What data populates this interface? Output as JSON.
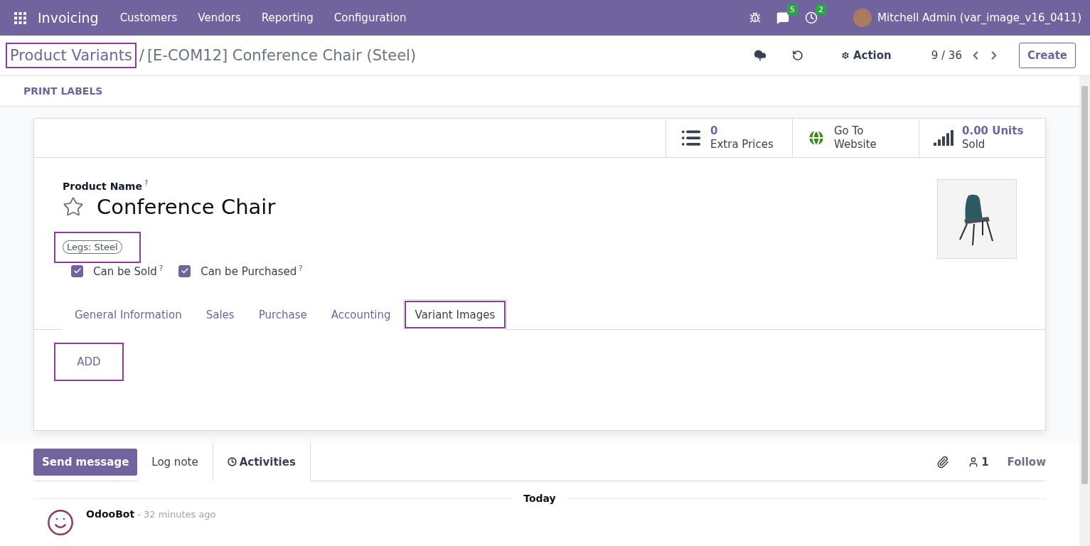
{
  "navbar": {
    "app": "Invoicing",
    "menus": [
      "Customers",
      "Vendors",
      "Reporting",
      "Configuration"
    ],
    "messages_count": "5",
    "activities_count": "2",
    "user": "Mitchell Admin (var_image_v16_0411)"
  },
  "breadcrumb": {
    "parent": "Product Variants",
    "parent_highlighted": true,
    "separator": "/",
    "current": "[E-COM12] Conference Chair (Steel)"
  },
  "control_panel": {
    "action": "Action",
    "pager": "9 / 36",
    "create": "Create"
  },
  "header_buttons": [
    "PRINT LABELS"
  ],
  "smart_buttons": [
    {
      "kind": "list",
      "value": "0",
      "label": "Extra Prices",
      "numeric": true
    },
    {
      "kind": "globe",
      "value": "Go To",
      "label": "Website",
      "numeric": false
    },
    {
      "kind": "bars",
      "value": "0.00 Units",
      "label": "Sold",
      "numeric": true
    }
  ],
  "form": {
    "field_label": "Product Name",
    "field_help": "?",
    "name": "Conference Chair",
    "favorite": false,
    "attributes": [
      {
        "label": "Legs: Steel",
        "highlighted": true
      }
    ],
    "options": [
      {
        "label": "Can be Sold",
        "help": "?",
        "checked": true
      },
      {
        "label": "Can be Purchased",
        "help": "?",
        "checked": true
      }
    ],
    "tabs": [
      {
        "label": "General Information",
        "selected": false,
        "highlighted": false
      },
      {
        "label": "Sales",
        "selected": false,
        "highlighted": false
      },
      {
        "label": "Purchase",
        "selected": false,
        "highlighted": false
      },
      {
        "label": "Accounting",
        "selected": false,
        "highlighted": false
      },
      {
        "label": "Variant Images",
        "selected": true,
        "highlighted": true
      }
    ],
    "add_button": {
      "label": "ADD",
      "highlighted": true
    }
  },
  "chatter": {
    "send": "Send message",
    "log": "Log note",
    "activities": "Activities",
    "followers": "1",
    "follow": "Follow",
    "date": "Today",
    "messages": [
      {
        "author": "OdooBot",
        "time": "- 32 minutes ago"
      }
    ]
  }
}
